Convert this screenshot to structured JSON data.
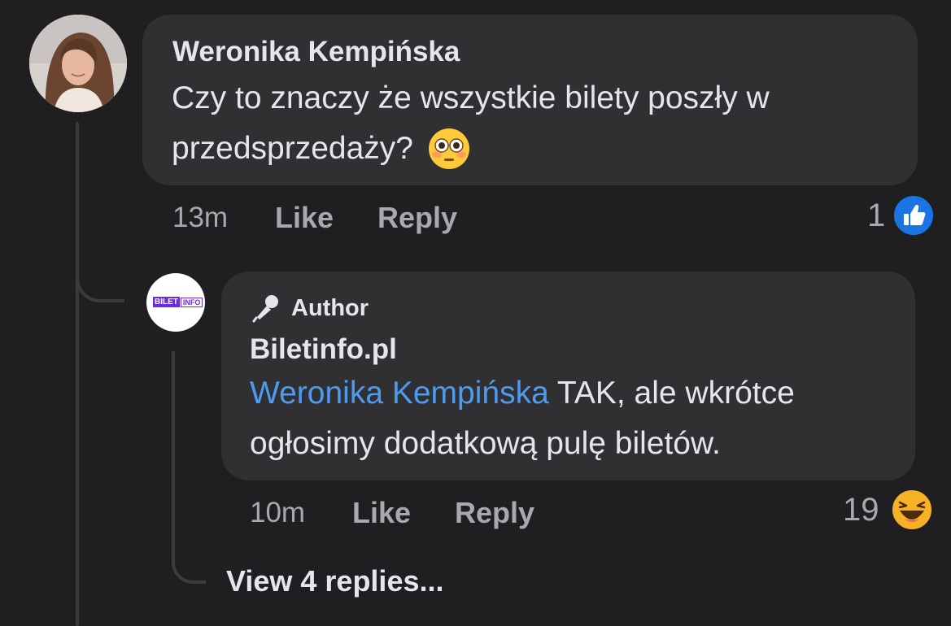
{
  "comment": {
    "author": "Weronika Kempińska",
    "text": "Czy to znaczy że wszystkie bilety poszły w przedsprzedaży? 😳",
    "text_line1": "Czy to znaczy że wszystkie bilety poszły w",
    "text_line2": "przedsprzedaży?",
    "emoji": "flushed-face",
    "time": "13m",
    "like_label": "Like",
    "reply_label": "Reply",
    "reaction_count": "1",
    "reaction_type": "like"
  },
  "reply": {
    "badge": "Author",
    "badge_icon": "microphone-icon",
    "author": "Biletinfo.pl",
    "avatar_logo_left": "BILET",
    "avatar_logo_right": "INFO",
    "mention": "Weronika Kempińska",
    "text_line1": " TAK, ale wkrótce",
    "text_line2": "ogłosimy dodatkową pulę biletów.",
    "time": "10m",
    "like_label": "Like",
    "reply_label": "Reply",
    "reaction_count": "19",
    "reaction_type": "haha"
  },
  "view_replies": "View 4 replies...",
  "colors": {
    "background": "#1f1f21",
    "bubble": "#303033",
    "mention": "#4e9aee",
    "like_blue": "#1b74e4",
    "muted_text": "#a7a9ad",
    "logo_purple": "#6a2ce0"
  }
}
